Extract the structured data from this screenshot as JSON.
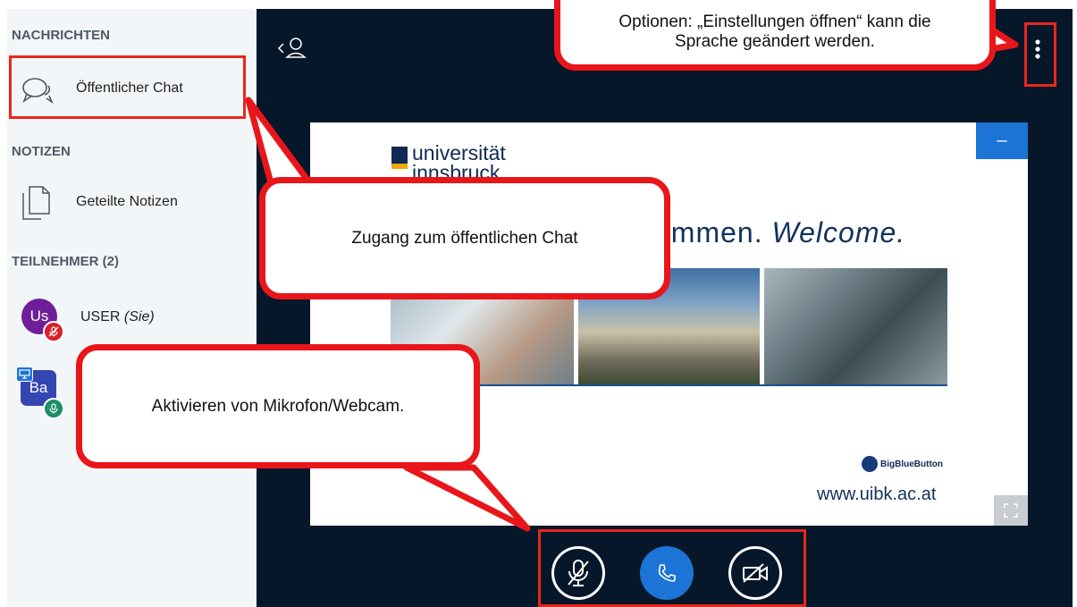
{
  "sidebar": {
    "messages_title": "NACHRICHTEN",
    "public_chat_label": "Öffentlicher Chat",
    "notes_title": "NOTIZEN",
    "shared_notes_label": "Geteilte Notizen",
    "participants_title": "TEILNEHMER (2)",
    "users": [
      {
        "initials": "Us",
        "name": "USER",
        "suffix": "(Sie)",
        "color": "#6f1e9a"
      },
      {
        "initials": "Ba",
        "name": "",
        "suffix": "",
        "color": "#3446b0"
      }
    ]
  },
  "slide": {
    "logo_line1": "universität",
    "logo_line2": "innsbruck",
    "welcome_plain": "ommen.",
    "welcome_italic": "Welcome.",
    "brand": "BigBlueButton",
    "url": "www.uibk.ac.at",
    "minimize_label": "–"
  },
  "callouts": {
    "options": "Optionen: „Einstellungen öffnen“ kann die Sprache geändert werden.",
    "chat": "Zugang zum öffentlichen Chat",
    "mic": "Aktivieren von Mikrofon/Webcam."
  },
  "icons": {
    "chat": "chat-bubbles-icon",
    "notes": "documents-icon",
    "user_list": "user-list-icon",
    "options": "vertical-dots-icon",
    "mic": "mic-muted-icon",
    "phone": "phone-icon",
    "webcam": "webcam-off-icon",
    "fullscreen": "fullscreen-icon"
  },
  "colors": {
    "accent": "#1b74d6",
    "annotation": "#e8161a",
    "stage_bg": "#06172a",
    "sidebar_bg": "#f3f6f9"
  }
}
